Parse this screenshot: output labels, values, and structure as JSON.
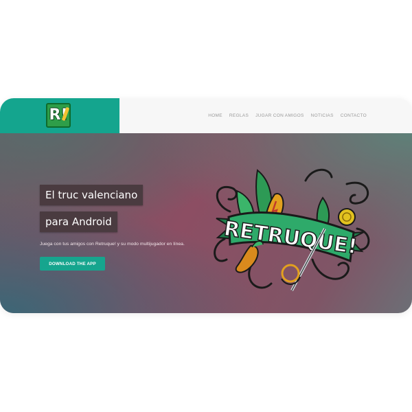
{
  "nav": {
    "logo_text": "R!",
    "menu": [
      "HOME",
      "REGLAS",
      "JUGAR CON AMIGOS",
      "NOTICIAS",
      "CONTACTO"
    ]
  },
  "hero": {
    "headline_line1": "El truc valenciano",
    "headline_line2": "para Android",
    "subtitle": "Juega con tus amigos con Retruque! y su modo multijugador en línea.",
    "cta_label": "DOWNLOAD THE APP",
    "banner_text": "RETRUQUE!"
  },
  "colors": {
    "nav_accent": "#14a58e",
    "button": "#16a58e",
    "headline_bg": "#4a3b40",
    "banner": "#2eaa6a"
  },
  "icons": [
    "logo-r-icon",
    "sword-icon",
    "chili-icon",
    "coin-icon",
    "club-icon"
  ]
}
